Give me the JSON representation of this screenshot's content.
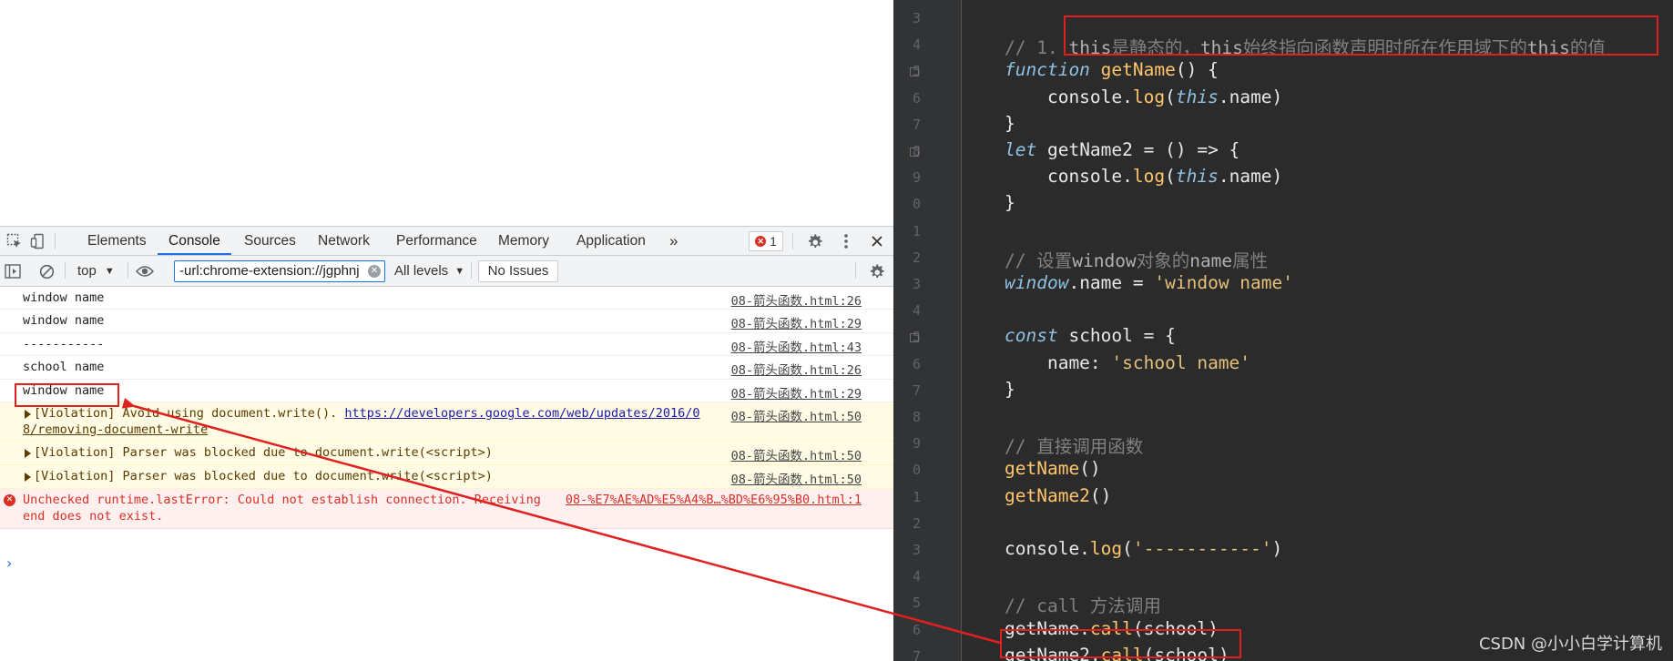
{
  "devtools": {
    "tabs": [
      "Elements",
      "Console",
      "Sources",
      "Network",
      "Performance",
      "Memory",
      "Application"
    ],
    "active_tab": "Console",
    "more_tabs_glyph": "»",
    "error_count": "1",
    "toolbar": {
      "context": "top",
      "filter_value": "-url:chrome-extension://jgphnj",
      "levels": "All levels",
      "issues": "No Issues"
    },
    "console_rows": [
      {
        "type": "log",
        "msg": "window name",
        "src": "08-箭头函数.html:26"
      },
      {
        "type": "log",
        "msg": "window name",
        "src": "08-箭头函数.html:29"
      },
      {
        "type": "log",
        "msg": "-----------",
        "src": "08-箭头函数.html:43"
      },
      {
        "type": "log",
        "msg": "school name",
        "src": "08-箭头函数.html:26"
      },
      {
        "type": "log",
        "msg": "window name",
        "src": "08-箭头函数.html:29"
      },
      {
        "type": "warn",
        "msg_prefix": "[Violation] Avoid using document.write(). ",
        "msg_link": "https://developers.google.com/web/updates/2016/0",
        "msg_link2": "8/removing-document-write",
        "src": "08-箭头函数.html:50"
      },
      {
        "type": "warn",
        "msg": "[Violation] Parser was blocked due to document.write(<script>)",
        "src": "08-箭头函数.html:50"
      },
      {
        "type": "warn",
        "msg": "[Violation] Parser was blocked due to document.write(<script>)",
        "src": "08-箭头函数.html:50"
      },
      {
        "type": "error",
        "msg": "Unchecked runtime.lastError: Could not establish connection. Receiving",
        "msg2": "end does not exist.",
        "src": "08-%E7%AE%AD%E5%A4%B…%BD%E6%95%B0.html:1"
      }
    ],
    "prompt": "›"
  },
  "editor": {
    "line_numbers": [
      "3",
      "4",
      "5",
      "6",
      "7",
      "8",
      "9",
      "0",
      "1",
      "2",
      "3",
      "4",
      "5",
      "6",
      "7",
      "8",
      "9",
      "0",
      "1",
      "2",
      "3",
      "4",
      "5",
      "6",
      "7"
    ],
    "lines": [
      {
        "parts": []
      },
      {
        "parts": [
          {
            "c": "cmt",
            "t": "// 1. "
          },
          {
            "c": "cmt-strong",
            "t": "this"
          },
          {
            "c": "cmt",
            "t": "是静态的，"
          },
          {
            "c": "cmt-strong",
            "t": "this"
          },
          {
            "c": "cmt",
            "t": "始终指向函数声明时所在作用域下的"
          },
          {
            "c": "cmt-strong",
            "t": "this"
          },
          {
            "c": "cmt",
            "t": "的值"
          }
        ]
      },
      {
        "parts": [
          {
            "c": "kw-i",
            "t": "function "
          },
          {
            "c": "fn",
            "t": "getName"
          },
          {
            "c": "",
            "t": "() {"
          }
        ]
      },
      {
        "parts": [
          {
            "c": "",
            "t": "    console."
          },
          {
            "c": "call",
            "t": "log"
          },
          {
            "c": "",
            "t": "("
          },
          {
            "c": "this-i",
            "t": "this"
          },
          {
            "c": "",
            "t": ".name)"
          }
        ]
      },
      {
        "parts": [
          {
            "c": "",
            "t": "}"
          }
        ]
      },
      {
        "parts": [
          {
            "c": "kw-i",
            "t": "let "
          },
          {
            "c": "",
            "t": "getName2 = () => {"
          }
        ]
      },
      {
        "parts": [
          {
            "c": "",
            "t": "    console."
          },
          {
            "c": "call",
            "t": "log"
          },
          {
            "c": "",
            "t": "("
          },
          {
            "c": "this-i",
            "t": "this"
          },
          {
            "c": "",
            "t": ".name)"
          }
        ]
      },
      {
        "parts": [
          {
            "c": "",
            "t": "}"
          }
        ]
      },
      {
        "parts": []
      },
      {
        "parts": [
          {
            "c": "cmt",
            "t": "// 设置"
          },
          {
            "c": "cmt-strong",
            "t": "window"
          },
          {
            "c": "cmt",
            "t": "对象的"
          },
          {
            "c": "cmt-strong",
            "t": "name"
          },
          {
            "c": "cmt",
            "t": "属性"
          }
        ]
      },
      {
        "parts": [
          {
            "c": "kw-i",
            "t": "window"
          },
          {
            "c": "",
            "t": ".name = "
          },
          {
            "c": "str",
            "t": "'window name'"
          }
        ]
      },
      {
        "parts": []
      },
      {
        "parts": [
          {
            "c": "kw-i",
            "t": "const "
          },
          {
            "c": "",
            "t": "school = {"
          }
        ]
      },
      {
        "parts": [
          {
            "c": "",
            "t": "    name: "
          },
          {
            "c": "str",
            "t": "'school name'"
          }
        ]
      },
      {
        "parts": [
          {
            "c": "",
            "t": "}"
          }
        ]
      },
      {
        "parts": []
      },
      {
        "parts": [
          {
            "c": "cmt",
            "t": "// 直接调用函数"
          }
        ]
      },
      {
        "parts": [
          {
            "c": "fn",
            "t": "getName"
          },
          {
            "c": "",
            "t": "()"
          }
        ]
      },
      {
        "parts": [
          {
            "c": "fn",
            "t": "getName2"
          },
          {
            "c": "",
            "t": "()"
          }
        ]
      },
      {
        "parts": []
      },
      {
        "parts": [
          {
            "c": "",
            "t": "console."
          },
          {
            "c": "call",
            "t": "log"
          },
          {
            "c": "",
            "t": "("
          },
          {
            "c": "str",
            "t": "'-----------'"
          },
          {
            "c": "",
            "t": ")"
          }
        ]
      },
      {
        "parts": []
      },
      {
        "parts": [
          {
            "c": "cmt",
            "t": "// call 方法调用"
          }
        ]
      },
      {
        "parts": [
          {
            "c": "",
            "t": "getName."
          },
          {
            "c": "call",
            "t": "call"
          },
          {
            "c": "",
            "t": "(school)"
          }
        ]
      },
      {
        "parts": [
          {
            "c": "",
            "t": "getName2."
          },
          {
            "c": "call",
            "t": "call"
          },
          {
            "c": "",
            "t": "(school)"
          }
        ]
      }
    ],
    "fold_markers": [
      2,
      5,
      12
    ]
  },
  "watermark": "CSDN @小小白学计算机",
  "colors": {
    "annotation_red": "#e02020",
    "devtools_blue": "#1a73e8",
    "editor_bg": "#2b2b2b"
  }
}
